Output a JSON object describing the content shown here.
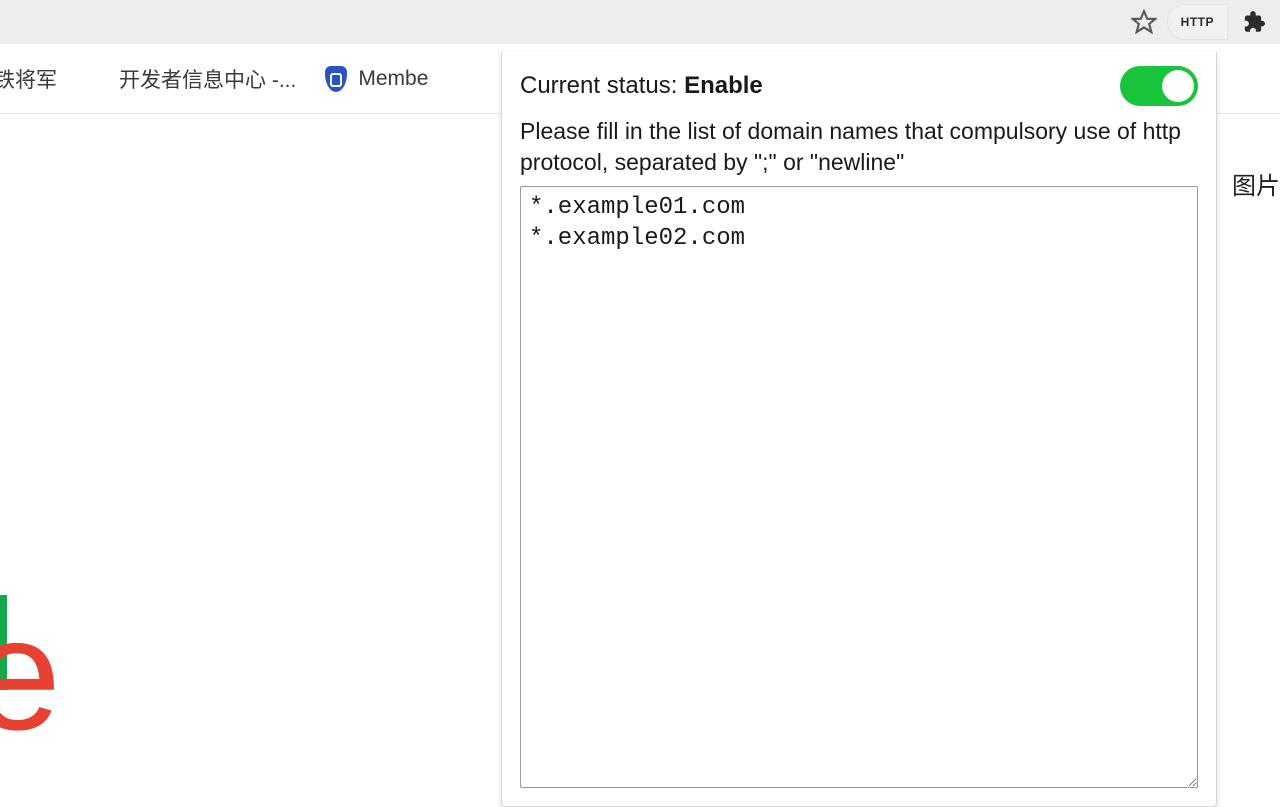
{
  "addrbar": {
    "ext_label": "HTTP"
  },
  "bookmarks": {
    "items": [
      {
        "label": "铁将军"
      },
      {
        "label": "开发者信息中心 -..."
      },
      {
        "label": "Membe"
      }
    ]
  },
  "page": {
    "right_text": "图片",
    "google_e": "e"
  },
  "popup": {
    "title_prefix": "Current status: ",
    "title_status": "Enable",
    "desc": "Please fill in the list of domain names that compulsory use of http protocol, separated by \";\" or \"newline\"",
    "textarea_value": "*.example01.com\n*.example02.com",
    "toggle_on": true
  }
}
